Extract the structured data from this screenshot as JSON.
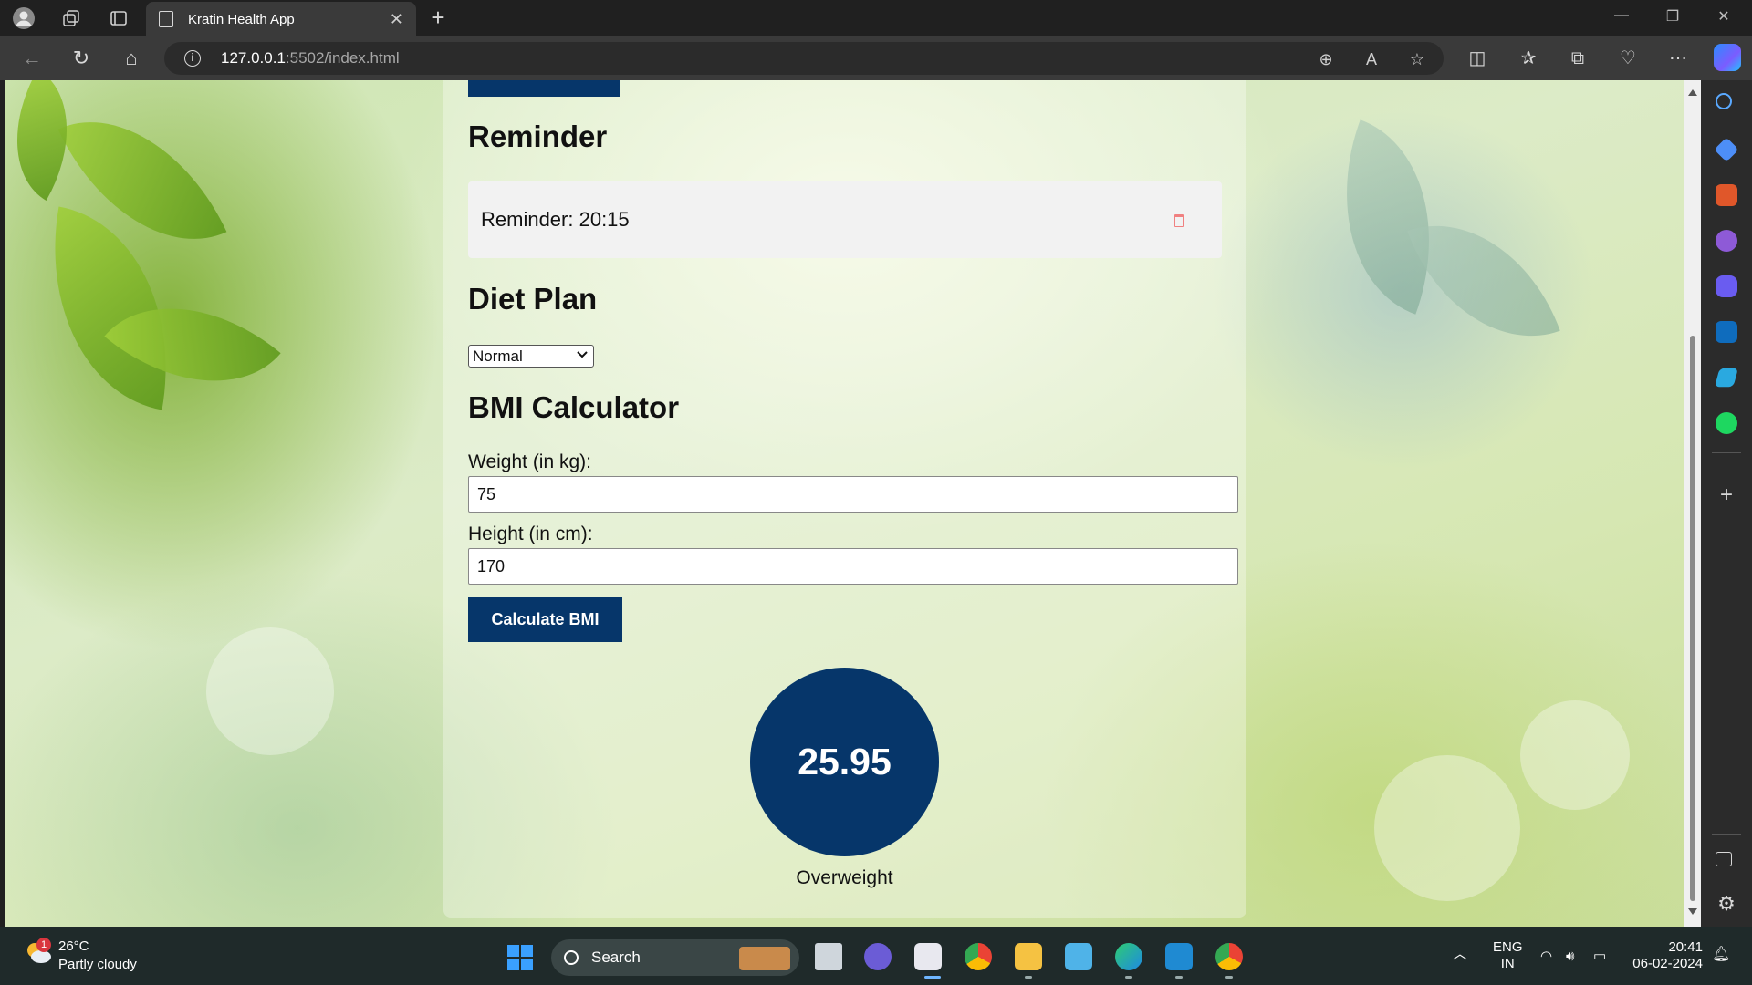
{
  "browser": {
    "tab_title": "Kratin Health App",
    "url_host": "127.0.0.1",
    "url_rest": ":5502/index.html"
  },
  "page": {
    "reminder": {
      "heading": "Reminder",
      "item_text": "Reminder: 20:15"
    },
    "diet": {
      "heading": "Diet Plan",
      "selected": "Normal"
    },
    "bmi": {
      "heading": "BMI Calculator",
      "weight_label": "Weight (in kg):",
      "weight_value": "75",
      "height_label": "Height (in cm):",
      "height_value": "170",
      "button_label": "Calculate BMI",
      "result": "25.95",
      "status": "Overweight"
    },
    "colors": {
      "primary": "#06366a",
      "reminder_bg": "#f2f2f2",
      "trash": "#f08080"
    }
  },
  "taskbar": {
    "weather_temp": "26°C",
    "weather_desc": "Partly cloudy",
    "weather_badge": "1",
    "search_label": "Search",
    "lang_line1": "ENG",
    "lang_line2": "IN",
    "time": "20:41",
    "date": "06-02-2024"
  }
}
